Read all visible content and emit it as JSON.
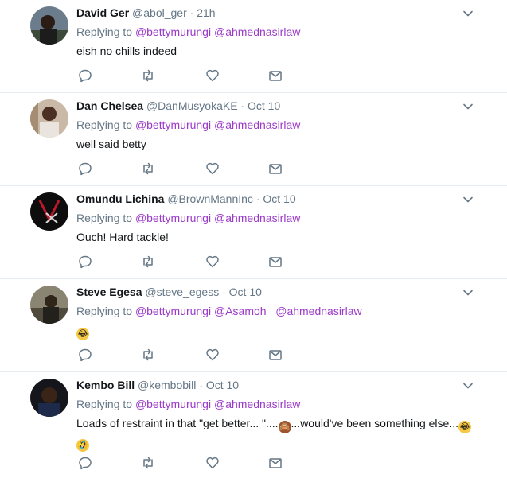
{
  "tweets": [
    {
      "name": "David Ger",
      "handle": "@abol_ger",
      "dot": "·",
      "time": "21h",
      "replying_prefix": "Replying to",
      "mentions": [
        "@bettymurungi",
        "@ahmednasirlaw"
      ],
      "text": "eish no chills indeed"
    },
    {
      "name": "Dan Chelsea",
      "handle": "@DanMusyokaKE",
      "dot": "·",
      "time": "Oct 10",
      "replying_prefix": "Replying to",
      "mentions": [
        "@bettymurungi",
        "@ahmednasirlaw"
      ],
      "text": "well said betty"
    },
    {
      "name": "Omundu Lichina",
      "handle": "@BrownMannInc",
      "dot": "·",
      "time": "Oct 10",
      "replying_prefix": "Replying to",
      "mentions": [
        "@bettymurungi",
        "@ahmednasirlaw"
      ],
      "text": "Ouch! Hard tackle!"
    },
    {
      "name": "Steve Egesa",
      "handle": "@steve_egess",
      "dot": "·",
      "time": "Oct 10",
      "replying_prefix": "Replying to",
      "mentions": [
        "@bettymurungi",
        "@Asamoh_",
        "@ahmednasirlaw"
      ],
      "text": "😂"
    },
    {
      "name": "Kembo Bill",
      "handle": "@kembobill",
      "dot": "·",
      "time": "Oct 10",
      "replying_prefix": "Replying to",
      "mentions": [
        "@bettymurungi",
        "@ahmednasirlaw"
      ],
      "text_part1": "Loads of restraint in that \"get better... \"....",
      "text_part2": "...would've been something else...",
      "emoji_monkey": "🙈",
      "emoji_laugh": "😂",
      "emoji_rofl": "🤣"
    }
  ],
  "actions": [
    "reply-icon",
    "retweet-icon",
    "like-icon",
    "message-icon"
  ],
  "colors": {
    "mention": "#9b3ac8",
    "muted": "#657786",
    "divider": "#e6ecf0",
    "icon": "#657786"
  }
}
